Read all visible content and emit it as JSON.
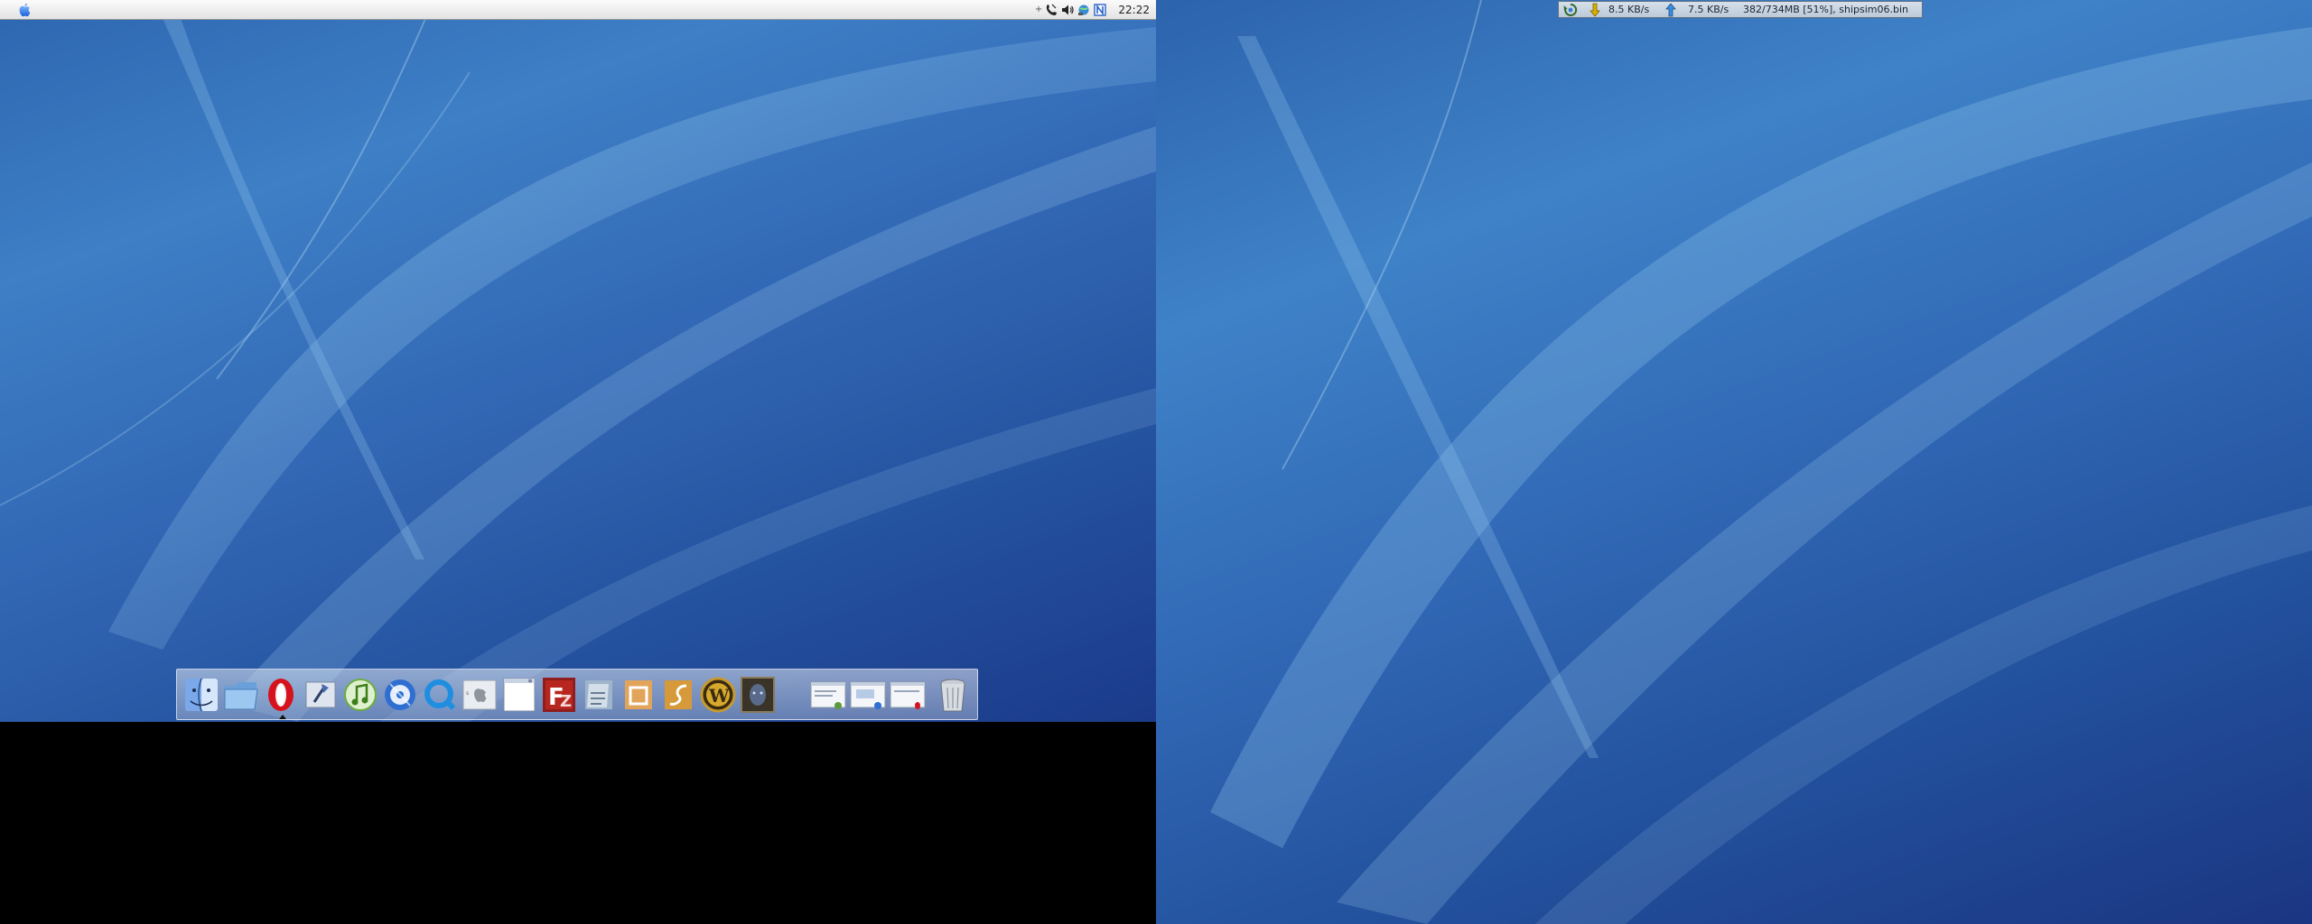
{
  "menubar": {
    "apple_menu": "apple-icon",
    "clock": "22:22",
    "tray_icons": [
      "tray-separator",
      "phone-icon",
      "volume-icon",
      "network-icon",
      "app-n-icon"
    ]
  },
  "netmeter": {
    "download_rate": "8.5 KB/s",
    "upload_rate": "7.5 KB/s",
    "transfer_status": "382/734MB [51%], shipsim06.bin",
    "progress_fraction": 0.51
  },
  "dock": {
    "items": [
      {
        "name": "finder-icon"
      },
      {
        "name": "folder-icon"
      },
      {
        "name": "opera-icon"
      },
      {
        "name": "mail-icon"
      },
      {
        "name": "itunes-icon"
      },
      {
        "name": "dvd-player-icon"
      },
      {
        "name": "quicktime-icon"
      },
      {
        "name": "about-mac-icon"
      },
      {
        "name": "document-icon"
      },
      {
        "name": "filezilla-icon"
      },
      {
        "name": "file-manager-icon"
      },
      {
        "name": "office-icon"
      },
      {
        "name": "flash-icon"
      },
      {
        "name": "world-of-warcraft-icon"
      },
      {
        "name": "warcraft-character-icon"
      },
      {
        "name": "minimized-window-1-icon"
      },
      {
        "name": "minimized-window-2-icon"
      },
      {
        "name": "minimized-window-3-icon"
      },
      {
        "name": "trash-icon"
      }
    ],
    "running_indicator_on": "opera-icon"
  },
  "colors": {
    "wallpaper_top": "#3e7fc6",
    "wallpaper_bottom": "#1b3a8a",
    "menubar": "#eeeeee",
    "netmeter": "#c8d4e1"
  }
}
